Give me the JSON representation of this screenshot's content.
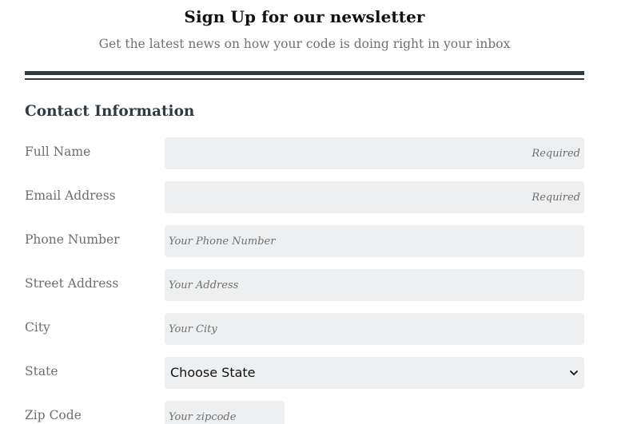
{
  "header": {
    "title": "Sign Up for our newsletter",
    "subtitle": "Get the latest news on how your code is doing right in your inbox"
  },
  "section": {
    "heading": "Contact Information"
  },
  "fields": {
    "full_name": {
      "label": "Full Name",
      "value": "",
      "placeholder": "Required"
    },
    "email": {
      "label": "Email Address",
      "value": "",
      "placeholder": "Required"
    },
    "phone": {
      "label": "Phone Number",
      "value": "",
      "placeholder": "Your Phone Number"
    },
    "street": {
      "label": "Street Address",
      "value": "",
      "placeholder": "Your Address"
    },
    "city": {
      "label": "City",
      "value": "",
      "placeholder": "Your City"
    },
    "state": {
      "label": "State",
      "selected": "Choose State",
      "icon": "chevron-down-icon"
    },
    "zip": {
      "label": "Zip Code",
      "value": "",
      "placeholder": "Your zipcode"
    }
  },
  "colors": {
    "text_dark": "#2f3a42",
    "text_muted": "#6e6e6e",
    "input_bg": "#eeeff0",
    "divider": "#2f3a42"
  }
}
